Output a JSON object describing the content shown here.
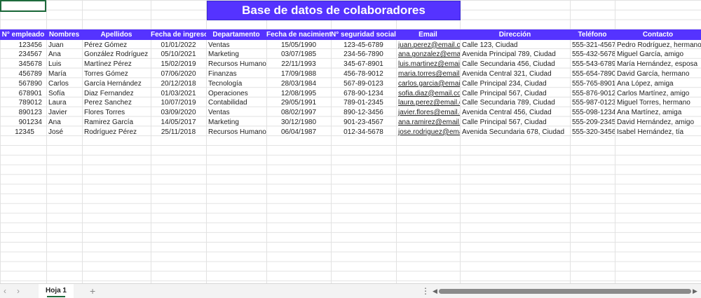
{
  "sheet": {
    "title": "Base de datos de colaboradores",
    "headers": [
      "N° empleado",
      "Nombres",
      "Apellidos",
      "Fecha de ingreso",
      "Departamento",
      "Fecha de nacimiento",
      "N° seguridad social",
      "Email",
      "Dirección",
      "Teléfono",
      "Contacto"
    ],
    "rows": [
      [
        "123456",
        "Juan",
        "Pérez Gómez",
        "01/01/2022",
        "Ventas",
        "15/05/1990",
        "123-45-6789",
        "juan.perez@email.com",
        "Calle 123, Ciudad",
        "555-321-4567",
        "Pedro Rodríguez, hermano"
      ],
      [
        "234567",
        "Ana",
        "González Rodríguez",
        "05/10/2021",
        "Marketing",
        "03/07/1985",
        "234-56-7890",
        "ana.gonzalez@email.c",
        "Avenida Principal 789, Ciudad",
        "555-432-5678",
        "Miguel García, amigo"
      ],
      [
        "345678",
        "Luis",
        "Martínez Pérez",
        "15/02/2019",
        "Recursos Humanos",
        "22/11/1993",
        "345-67-8901",
        "luis.martinez@email.c",
        "Calle Secundaria 456, Ciudad",
        "555-543-6789",
        "María Hernández, esposa"
      ],
      [
        "456789",
        "María",
        "Torres Gómez",
        "07/06/2020",
        "Finanzas",
        "17/09/1988",
        "456-78-9012",
        "maria.torres@email.co",
        "Avenida Central 321, Ciudad",
        "555-654-7890",
        "David García, hermano"
      ],
      [
        "567890",
        "Carlos",
        "García Hernández",
        "20/12/2018",
        "Tecnología",
        "28/03/1984",
        "567-89-0123",
        "carlos.garcia@email.c",
        "Calle Principal 234, Ciudad",
        "555-765-8901",
        "Ana López, amiga"
      ],
      [
        "678901",
        "Sofía",
        "Diaz Fernandez",
        "01/03/2021",
        "Operaciones",
        "12/08/1995",
        "678-90-1234",
        "sofia.diaz@email.com",
        "Calle Principal 567, Ciudad",
        "555-876-9012",
        "Carlos Martínez, amigo"
      ],
      [
        "789012",
        "Laura",
        "Perez Sanchez",
        "10/07/2019",
        "Contabilidad",
        "29/05/1991",
        "789-01-2345",
        "laura.perez@email.com",
        "Calle Secundaria 789, Ciudad",
        "555-987-0123",
        "Miguel Torres, hermano"
      ],
      [
        "890123",
        "Javier",
        "Flores Torres",
        "03/09/2020",
        "Ventas",
        "08/02/1997",
        "890-12-3456",
        "javier.flores@email.com",
        "Avenida Central 456, Ciudad",
        "555-098-1234",
        "Ana Martínez, amiga"
      ],
      [
        "901234",
        "Ana",
        "Ramirez García",
        "14/05/2017",
        "Marketing",
        "30/12/1980",
        "901-23-4567",
        "ana.ramirez@email.com",
        "Calle Principal 567, Ciudad",
        "555-209-2345",
        "David Hernández, amigo"
      ],
      [
        "12345",
        "José",
        "Rodríguez Pérez",
        "25/11/2018",
        "Recursos Humanos",
        "06/04/1987",
        "012-34-5678",
        "jose.rodriguez@email.c",
        "Avenida Secundaria 678, Ciudad",
        "555-320-3456",
        "Isabel Hernández, tía"
      ]
    ]
  },
  "footer": {
    "sheet_tab": "Hoja 1",
    "add_sheet": "+",
    "nav_prev": "‹",
    "nav_next": "›",
    "more": "⋮",
    "scroll_left": "◀",
    "scroll_right": "▶"
  },
  "colors": {
    "header_bg": "#5533ff",
    "header_text": "#ffffff",
    "selection": "#1e6b3c"
  }
}
